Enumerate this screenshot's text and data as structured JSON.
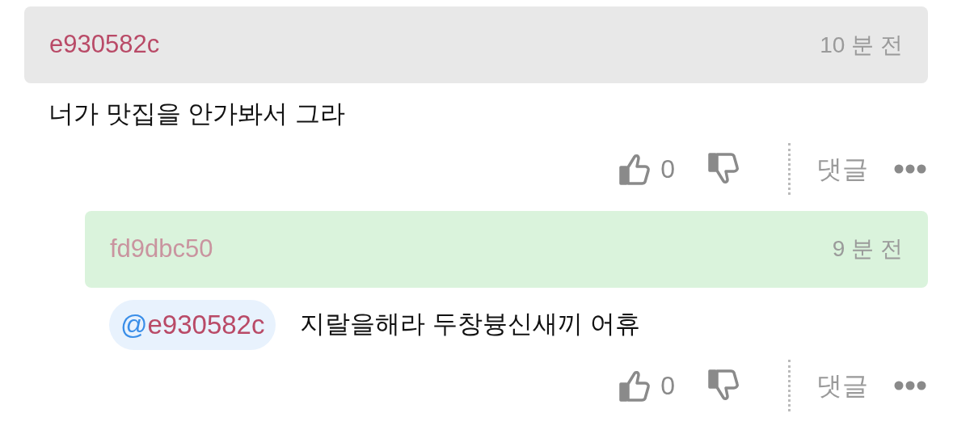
{
  "comments": [
    {
      "kind": "comment",
      "author": "e930582c",
      "time": "10 분 전",
      "text": "너가 맛집을 안가봐서 그라",
      "likes": "0",
      "reply_label": "댓글",
      "replies": [
        {
          "kind": "reply",
          "author": "fd9dbc50",
          "time": "9 분 전",
          "mention": {
            "at": "@",
            "name": "e930582c"
          },
          "text": "지랄을해라 두창븅신새끼 어휴",
          "likes": "0",
          "reply_label": "댓글"
        }
      ]
    }
  ]
}
